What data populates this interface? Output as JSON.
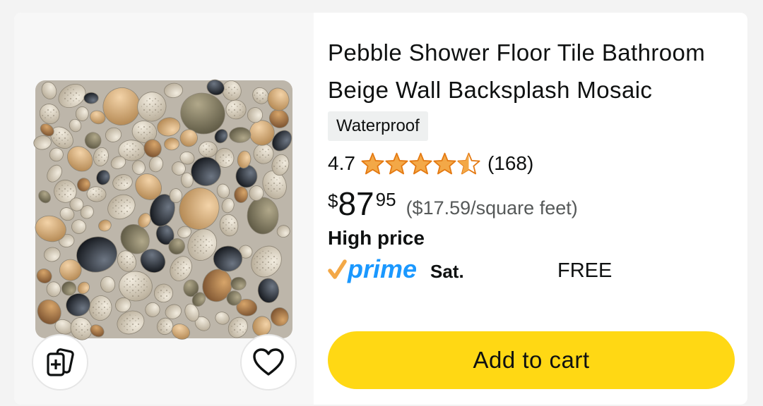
{
  "product": {
    "title": "Pebble Shower Floor Tile Bathroom Beige Wall Backsplash Mosaic",
    "badge": "Waterproof",
    "rating": "4.7",
    "rating_stars": 4.5,
    "review_count": "(168)",
    "price": {
      "currency": "$",
      "whole": "87",
      "fraction": "95"
    },
    "unit_price": "($17.59/square feet)",
    "price_note": "High price",
    "delivery": {
      "day": "Sat.",
      "cost": "FREE"
    },
    "add_to_cart_label": "Add to cart",
    "image_icon": "pebble-tile-image"
  },
  "icons": {
    "compare": "compare-cards-icon",
    "wishlist": "heart-icon",
    "prime": "prime-logo",
    "star": "star-icon"
  },
  "colors": {
    "star": "#f3a847",
    "star_outline": "#e47911",
    "cart_button": "#ffd814",
    "prime_blue": "#1a98ff",
    "prime_check": "#f3a847",
    "badge_bg": "#eef0f0"
  }
}
